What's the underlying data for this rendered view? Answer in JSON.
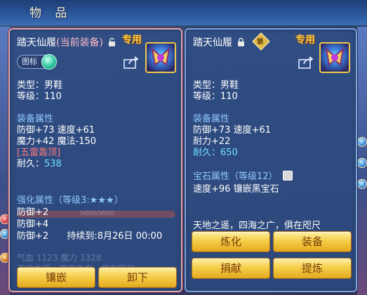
{
  "window": {
    "title": "物 品"
  },
  "left_panel": {
    "name": "踏天仙履",
    "equipped_tag": "(当前装备)",
    "exclusive": "专用",
    "mark_label": "图标",
    "type": "类型：男鞋",
    "level": "等级：110",
    "equip_attr_head": "装备属性",
    "attr_line1": "防御+73 速度+61",
    "attr_line2": "魔力+42 魔法-150",
    "special": "[五雷轰顶]",
    "durability_label": "耐久：",
    "durability_value": "538",
    "enhance_head": "强化属性（等级3:★★★）",
    "enhance1": "防御+2",
    "enhance2": "防御+4",
    "enhance3": "防御+2",
    "enhance3_duration": "持续到:8月26日 00:00",
    "faded_bar_text": "5000/5000",
    "faded_row1": "气血  1123     魔力  1328",
    "faded_row2": "天地之遥，四海之广，俱在咫尺",
    "buttons": {
      "inlay": "镶嵌",
      "unequip": "卸下"
    }
  },
  "right_panel": {
    "name": "踏天仙履",
    "exclusive": "专用",
    "badge": "锁",
    "type": "类型：男鞋",
    "level": "等级：110",
    "equip_attr_head": "装备属性",
    "attr_line1": "防御+73 速度+61",
    "attr_line2": "耐力+22",
    "durability_label": "耐久：",
    "durability_value": "650",
    "gem_head": "宝石属性（等级12）",
    "gem_line": "速度+96 镶嵌黑宝石",
    "description": "天地之遥，四海之广，俱在咫尺",
    "buttons": {
      "refine": "炼化",
      "equip": "装备",
      "donate": "捐献",
      "extract": "提炼"
    }
  }
}
